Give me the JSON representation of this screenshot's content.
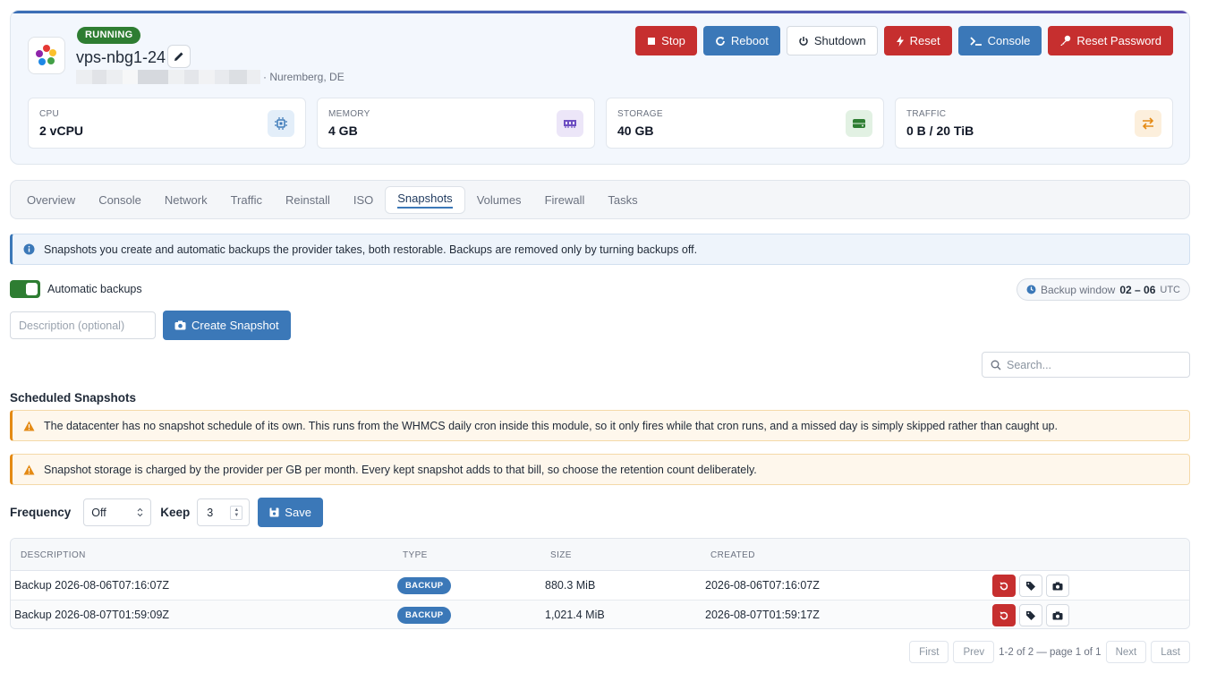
{
  "server": {
    "status": "RUNNING",
    "hostname": "vps-nbg1-24",
    "location": "· Nuremberg, DE"
  },
  "actions": [
    {
      "label": "Stop",
      "icon": "stop-icon",
      "style": "red"
    },
    {
      "label": "Reboot",
      "icon": "reboot-icon",
      "style": "blue"
    },
    {
      "label": "Shutdown",
      "icon": "power-icon",
      "style": "white"
    },
    {
      "label": "Reset",
      "icon": "bolt-icon",
      "style": "red"
    },
    {
      "label": "Console",
      "icon": "terminal-icon",
      "style": "blue"
    },
    {
      "label": "Reset Password",
      "icon": "key-icon",
      "style": "red"
    }
  ],
  "stats": [
    {
      "label": "CPU",
      "value": "2 vCPU",
      "icon": "chip-icon",
      "color": "#3b78b8"
    },
    {
      "label": "MEMORY",
      "value": "4 GB",
      "icon": "memory-icon",
      "color": "#6d4fc2"
    },
    {
      "label": "STORAGE",
      "value": "40 GB",
      "icon": "storage-icon",
      "color": "#2e7d32"
    },
    {
      "label": "TRAFFIC",
      "value": "0 B / 20 TiB",
      "icon": "transfer-icon",
      "color": "#e48a14"
    }
  ],
  "tabs": [
    "Overview",
    "Console",
    "Network",
    "Traffic",
    "Reinstall",
    "ISO",
    "Snapshots",
    "Volumes",
    "Firewall",
    "Tasks"
  ],
  "active_tab": "Snapshots",
  "info_text": "Snapshots you create and automatic backups the provider takes, both restorable. Backups are removed only by turning backups off.",
  "auto_backups": {
    "label": "Automatic backups",
    "enabled": true
  },
  "backup_window": {
    "label": "Backup window",
    "value": "02 – 06",
    "tz": "UTC"
  },
  "create": {
    "placeholder": "Description (optional)",
    "button": "Create Snapshot"
  },
  "search_placeholder": "Search...",
  "scheduled": {
    "title": "Scheduled Snapshots",
    "warning1": "The datacenter has no snapshot schedule of its own. This runs from the WHMCS daily cron inside this module, so it only fires while that cron runs, and a missed day is simply skipped rather than caught up.",
    "warning2": "Snapshot storage is charged by the provider per GB per month. Every kept snapshot adds to that bill, so choose the retention count deliberately.",
    "frequency_label": "Frequency",
    "frequency_value": "Off",
    "keep_label": "Keep",
    "keep_value": "3",
    "save_label": "Save"
  },
  "table": {
    "headers": [
      "DESCRIPTION",
      "TYPE",
      "SIZE",
      "CREATED"
    ],
    "rows": [
      {
        "description": "Backup 2026-08-06T07:16:07Z",
        "type": "BACKUP",
        "size": "880.3 MiB",
        "created": "2026-08-06T07:16:07Z"
      },
      {
        "description": "Backup 2026-08-07T01:59:09Z",
        "type": "BACKUP",
        "size": "1,021.4 MiB",
        "created": "2026-08-07T01:59:17Z"
      }
    ]
  },
  "pagination": {
    "first": "First",
    "prev": "Prev",
    "info": "1-2 of 2 — page 1 of 1",
    "next": "Next",
    "last": "Last"
  }
}
